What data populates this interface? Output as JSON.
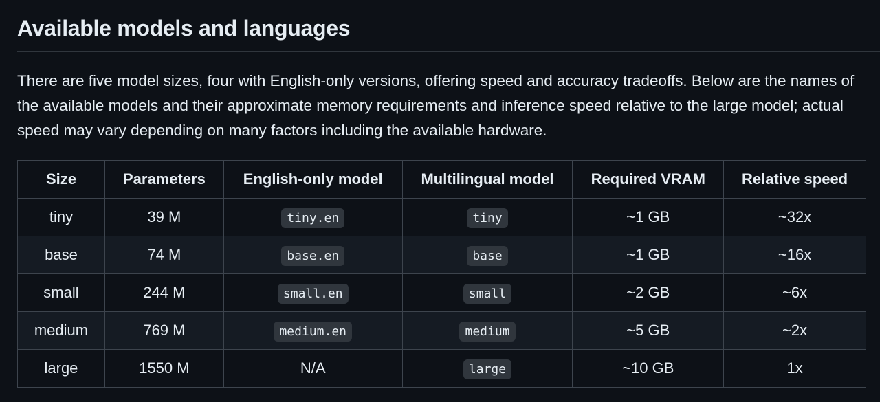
{
  "heading": "Available models and languages",
  "intro": "There are five model sizes, four with English-only versions, offering speed and accuracy tradeoffs. Below are the names of the available models and their approximate memory requirements and inference speed relative to the large model; actual speed may vary depending on many factors including the available hardware.",
  "table": {
    "headers": [
      "Size",
      "Parameters",
      "English-only model",
      "Multilingual model",
      "Required VRAM",
      "Relative speed"
    ],
    "rows": [
      {
        "size": "tiny",
        "parameters": "39 M",
        "english_only": "tiny.en",
        "multilingual": "tiny",
        "vram": "~1 GB",
        "speed": "~32x"
      },
      {
        "size": "base",
        "parameters": "74 M",
        "english_only": "base.en",
        "multilingual": "base",
        "vram": "~1 GB",
        "speed": "~16x"
      },
      {
        "size": "small",
        "parameters": "244 M",
        "english_only": "small.en",
        "multilingual": "small",
        "vram": "~2 GB",
        "speed": "~6x"
      },
      {
        "size": "medium",
        "parameters": "769 M",
        "english_only": "medium.en",
        "multilingual": "medium",
        "vram": "~5 GB",
        "speed": "~2x"
      },
      {
        "size": "large",
        "parameters": "1550 M",
        "english_only": "N/A",
        "multilingual": "large",
        "vram": "~10 GB",
        "speed": "1x"
      }
    ]
  }
}
